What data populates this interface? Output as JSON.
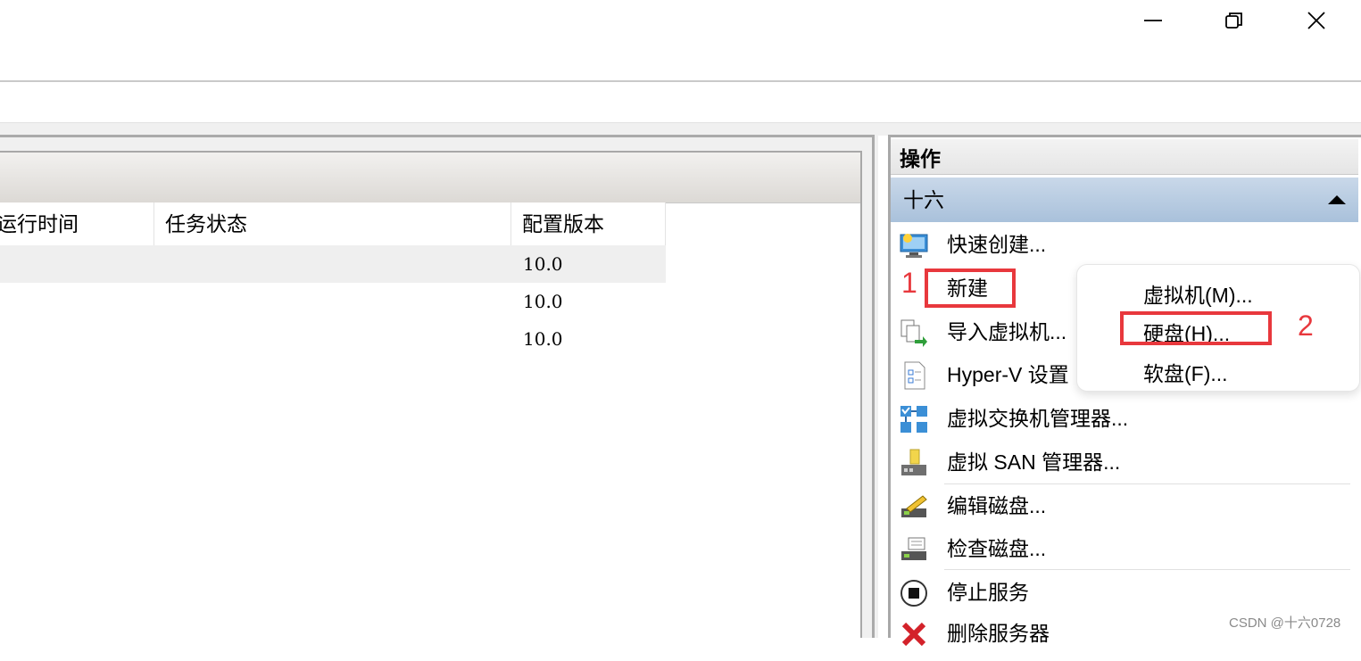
{
  "window": {
    "minimize_icon": "minimize-icon",
    "restore_icon": "restore-icon",
    "close_icon": "close-icon"
  },
  "vm_list": {
    "columns": [
      "运行时间",
      "任务状态",
      "配置版本"
    ],
    "rows": [
      {
        "uptime": "",
        "status": "",
        "config_version": "10.0"
      },
      {
        "uptime": "",
        "status": "",
        "config_version": "10.0"
      },
      {
        "uptime": "",
        "status": "",
        "config_version": "10.0"
      }
    ]
  },
  "actions": {
    "title": "操作",
    "group": "十六",
    "items": [
      {
        "label": "快速创建...",
        "icon": "quick-create-icon"
      },
      {
        "label": "新建",
        "icon": ""
      },
      {
        "label": "导入虚拟机...",
        "icon": "import-vm-icon"
      },
      {
        "label": "Hyper-V 设置",
        "icon": "settings-icon"
      },
      {
        "label": "虚拟交换机管理器...",
        "icon": "virtual-switch-icon"
      },
      {
        "label": "虚拟 SAN 管理器...",
        "icon": "virtual-san-icon"
      },
      {
        "label": "编辑磁盘...",
        "icon": "edit-disk-icon"
      },
      {
        "label": "检查磁盘...",
        "icon": "inspect-disk-icon"
      },
      {
        "label": "停止服务",
        "icon": "stop-service-icon"
      },
      {
        "label": "删除服务器",
        "icon": "delete-server-icon"
      }
    ]
  },
  "new_submenu": {
    "items": [
      "虚拟机(M)...",
      "硬盘(H)...",
      "软盘(F)..."
    ]
  },
  "annotations": {
    "step1": "1",
    "step2": "2",
    "color": "#e8383d"
  },
  "watermark": "CSDN @十六0728"
}
